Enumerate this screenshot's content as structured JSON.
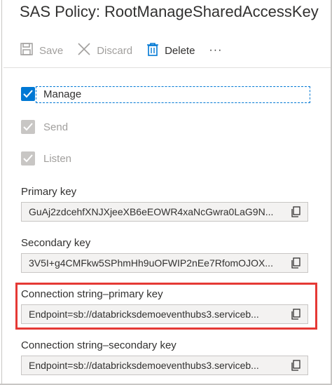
{
  "title": "SAS Policy: RootManageSharedAccessKey",
  "toolbar": {
    "save_label": "Save",
    "discard_label": "Discard",
    "delete_label": "Delete",
    "more_label": "···"
  },
  "checkboxes": [
    {
      "label": "Manage",
      "checked": true,
      "enabled": true
    },
    {
      "label": "Send",
      "checked": true,
      "enabled": false
    },
    {
      "label": "Listen",
      "checked": true,
      "enabled": false
    }
  ],
  "fields": {
    "primary_key": {
      "label": "Primary key",
      "value": "GuAj2zdcehfXNJXjeeXB6eEOWR4xaNcGwra0LaG9N..."
    },
    "secondary_key": {
      "label": "Secondary key",
      "value": "3V5I+g4CMFkw5SPhmHh9uOFWIP2nEe7RfomOJOX..."
    },
    "conn_primary": {
      "label": "Connection string–primary key",
      "value": "Endpoint=sb://databricksdemoeventhubs3.serviceb..."
    },
    "conn_secondary": {
      "label": "Connection string–secondary key",
      "value": "Endpoint=sb://databricksdemoeventhubs3.serviceb..."
    }
  },
  "colors": {
    "accent": "#0078d4",
    "highlight": "#e53935",
    "disabled": "#a19f9d"
  }
}
